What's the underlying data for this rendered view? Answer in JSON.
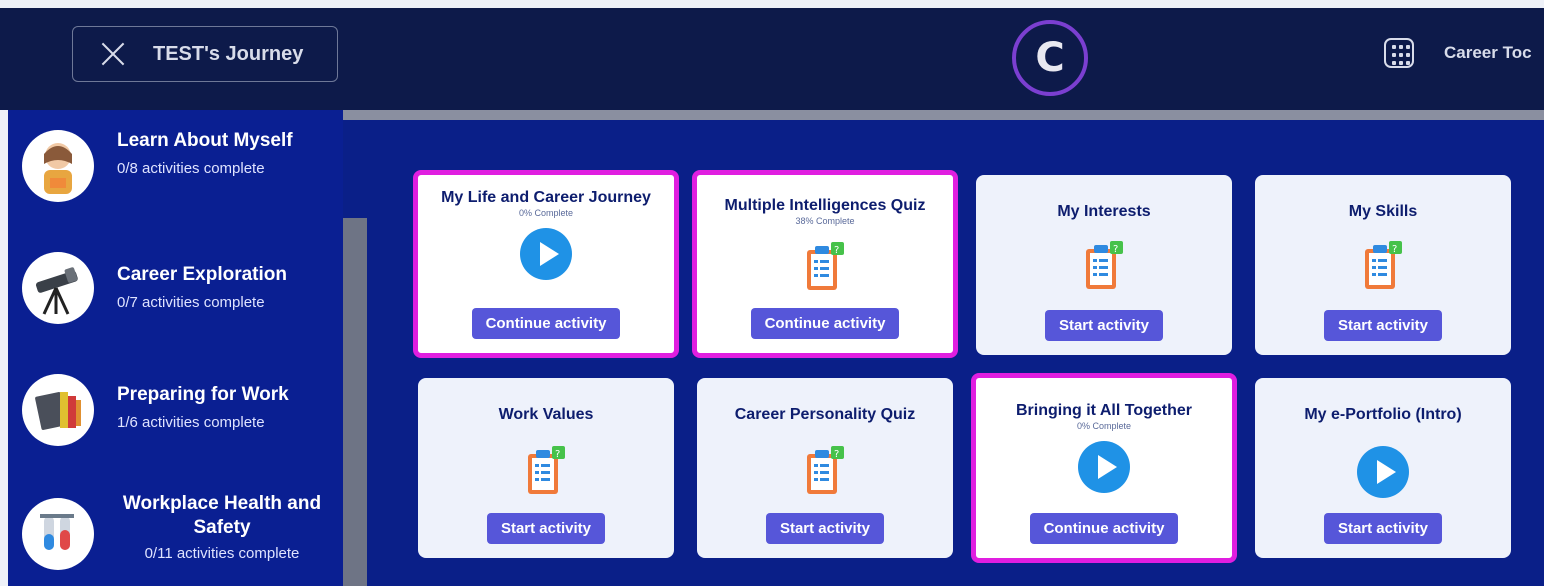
{
  "header": {
    "journey_title": "TEST's Journey",
    "tools_label": "Career Toc"
  },
  "sidebar": {
    "items": [
      {
        "title": "Learn About Myself",
        "sub": "0/8 activities complete"
      },
      {
        "title": "Career Exploration",
        "sub": "0/7 activities complete"
      },
      {
        "title": "Preparing for Work",
        "sub": "1/6 activities complete"
      },
      {
        "title": "Workplace Health and Safety",
        "sub": "0/11 activities complete"
      }
    ]
  },
  "cards": [
    {
      "title": "My Life and Career Journey",
      "pct": "0% Complete",
      "button": "Continue activity",
      "icon": "play-icon",
      "active": true
    },
    {
      "title": "Multiple Intelligences Quiz",
      "pct": "38% Complete",
      "button": "Continue activity",
      "icon": "quiz-icon",
      "active": true
    },
    {
      "title": "My Interests",
      "pct": "",
      "button": "Start activity",
      "icon": "quiz-icon",
      "active": false
    },
    {
      "title": "My Skills",
      "pct": "",
      "button": "Start activity",
      "icon": "quiz-icon",
      "active": false
    },
    {
      "title": "Work Values",
      "pct": "",
      "button": "Start activity",
      "icon": "quiz-icon",
      "active": false
    },
    {
      "title": "Career Personality Quiz",
      "pct": "",
      "button": "Start activity",
      "icon": "quiz-icon",
      "active": false
    },
    {
      "title": "Bringing it All Together",
      "pct": "0% Complete",
      "button": "Continue activity",
      "icon": "play-icon",
      "active": true
    },
    {
      "title": "My e-Portfolio (Intro)",
      "pct": "",
      "button": "Start activity",
      "icon": "play-icon",
      "active": false
    }
  ],
  "colors": {
    "header_bg": "#0d1a4a",
    "main_bg": "#0a1f88",
    "active_border": "#e01ee0",
    "button_bg": "#5656d9",
    "play_icon": "#1f92e6"
  }
}
